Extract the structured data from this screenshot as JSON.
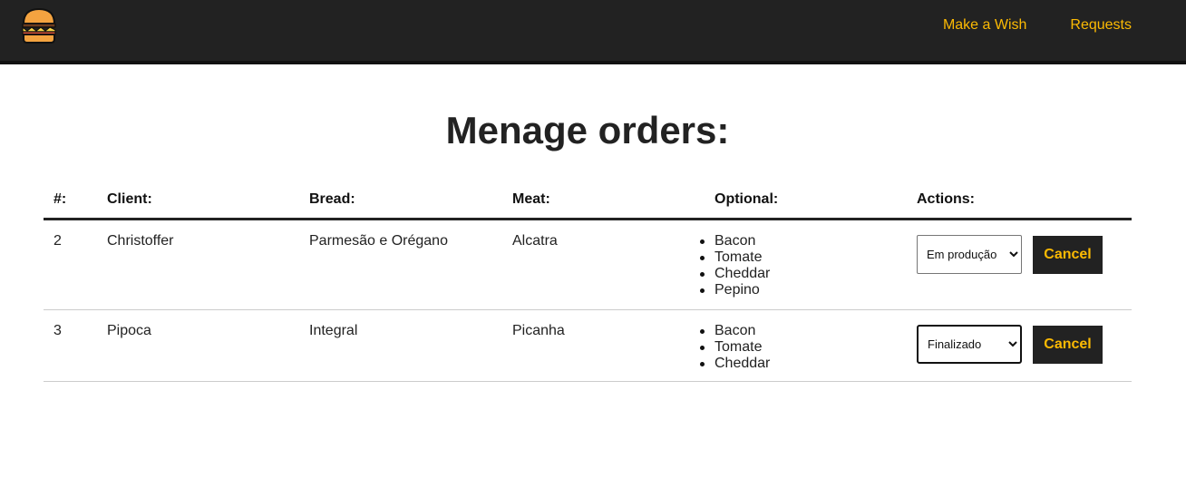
{
  "nav": {
    "logo_icon": "burger-icon",
    "links": [
      "Make a Wish",
      "Requests"
    ],
    "accent_color": "#fcba03",
    "bg_color": "#222222"
  },
  "page": {
    "title": "Menage orders:"
  },
  "table": {
    "headers": [
      "#:",
      "Client:",
      "Bread:",
      "Meat:",
      "Optional:",
      "Actions:"
    ],
    "rows": [
      {
        "id": "2",
        "client": "Christoffer",
        "bread": "Parmesão e Orégano",
        "meat": "Alcatra",
        "optional": [
          "Bacon",
          "Tomate",
          "Cheddar",
          "Pepino"
        ],
        "status": "Em produção",
        "cancel_label": "Cancel"
      },
      {
        "id": "3",
        "client": "Pipoca",
        "bread": "Integral",
        "meat": "Picanha",
        "optional": [
          "Bacon",
          "Tomate",
          "Cheddar"
        ],
        "status": "Finalizado",
        "cancel_label": "Cancel"
      }
    ]
  }
}
